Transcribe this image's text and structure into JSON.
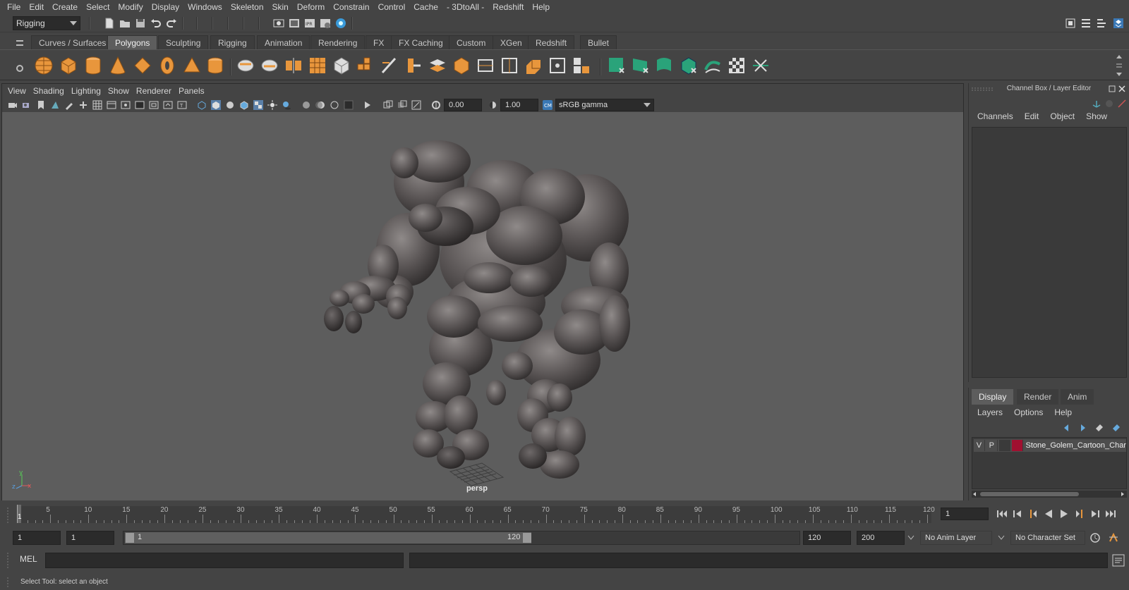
{
  "menubar": {
    "items": [
      "File",
      "Edit",
      "Create",
      "Select",
      "Modify",
      "Display",
      "Windows",
      "Skeleton",
      "Skin",
      "Deform",
      "Constrain",
      "Control",
      "Cache",
      "- 3DtoAll -",
      "Redshift",
      "Help"
    ]
  },
  "statusline": {
    "menuset": "Rigging"
  },
  "shelf": {
    "tabs": [
      "Curves / Surfaces",
      "Polygons",
      "Sculpting",
      "Rigging",
      "Animation",
      "Rendering",
      "FX",
      "FX Caching",
      "Custom",
      "XGen",
      "Redshift",
      "Bullet"
    ],
    "active_tab": "Polygons"
  },
  "viewport": {
    "menu": [
      "View",
      "Shading",
      "Lighting",
      "Show",
      "Renderer",
      "Panels"
    ],
    "exposure": "0.00",
    "gamma": "1.00",
    "color_space": "sRGB gamma",
    "camera_label": "persp",
    "axis_x": "x",
    "axis_y": "y",
    "axis_z": "z"
  },
  "channelbox": {
    "title": "Channel Box / Layer Editor",
    "menu": [
      "Channels",
      "Edit",
      "Object",
      "Show"
    ]
  },
  "layereditor": {
    "tabs": [
      "Display",
      "Render",
      "Anim"
    ],
    "active_tab": "Display",
    "menu": [
      "Layers",
      "Options",
      "Help"
    ],
    "layer": {
      "visibility": "V",
      "playback": "P",
      "name": "Stone_Golem_Cartoon_Char",
      "color": "#a01030"
    }
  },
  "timeslider": {
    "labels": [
      "5",
      "10",
      "15",
      "20",
      "25",
      "30",
      "35",
      "40",
      "45",
      "50",
      "55",
      "60",
      "65",
      "70",
      "75",
      "80",
      "85",
      "90",
      "95",
      "100",
      "105",
      "110",
      "115",
      "120"
    ],
    "current_marker": "1",
    "current_frame": "1"
  },
  "rangeslider": {
    "start_frame": "1",
    "playback_start": "1",
    "range_start_label": "1",
    "range_end_label": "120",
    "playback_end": "120",
    "end_frame": "200",
    "anim_layer": "No Anim Layer",
    "character_set": "No Character Set"
  },
  "commandline": {
    "label": "MEL"
  },
  "helpline": {
    "text": "Select Tool: select an object"
  },
  "colors": {
    "accent": "#5d5d5d",
    "viewport_bg": "#5d5d5d",
    "layer_red": "#a01030",
    "shelf_orange": "#e8963c",
    "shelf_green": "#2aa37a"
  }
}
